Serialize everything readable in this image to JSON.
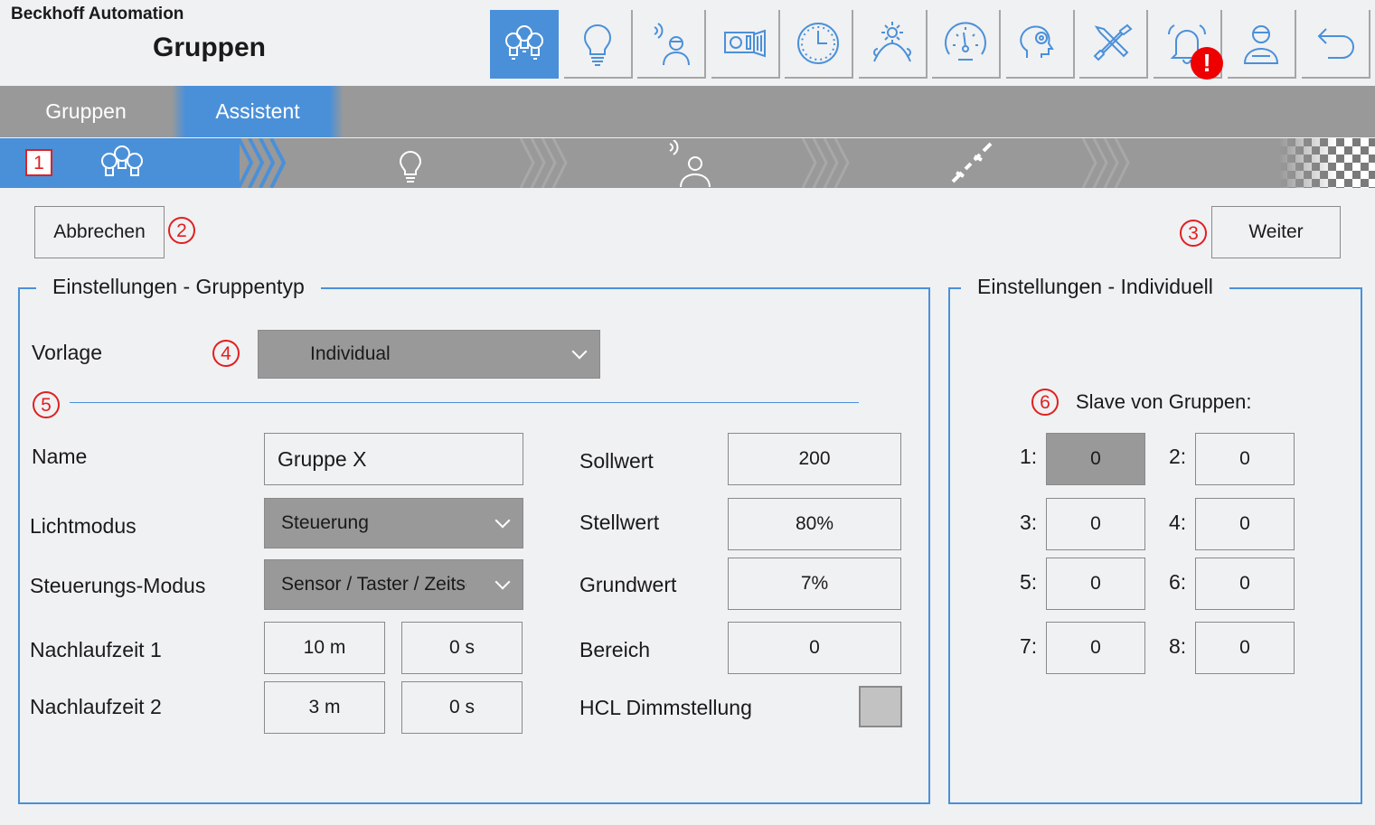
{
  "header": {
    "company": "Beckhoff Automation",
    "title": "Gruppen"
  },
  "toolbar": {
    "icons": [
      "groups-icon",
      "bulb-icon",
      "presence-sensor-icon",
      "projector-icon",
      "clock-icon",
      "daylight-icon",
      "speedometer-icon",
      "settings-head-icon",
      "tools-icon",
      "alarm-bell-icon",
      "user-icon",
      "back-icon"
    ],
    "alarm_badge": "!"
  },
  "tabs": [
    {
      "label": "Gruppen",
      "active": false
    },
    {
      "label": "Assistent",
      "active": true
    }
  ],
  "wizard": {
    "steps": [
      "groups-icon",
      "bulb-icon",
      "presence-sensor-icon",
      "link-broken-icon",
      "finish-flag-icon"
    ],
    "active_step": 0
  },
  "markers": {
    "m1": "1",
    "m2": "2",
    "m3": "3",
    "m4": "4",
    "m5": "5",
    "m6": "6"
  },
  "actions": {
    "cancel_label": "Abbrechen",
    "next_label": "Weiter"
  },
  "group_type": {
    "legend": "Einstellungen - Gruppentyp",
    "template_label": "Vorlage",
    "template_value": "Individual",
    "name_label": "Name",
    "name_value": "Gruppe X",
    "light_mode_label": "Lichtmodus",
    "light_mode_value": "Steuerung",
    "control_mode_label": "Steuerungs-Modus",
    "control_mode_value": "Sensor / Taster / Zeitschaltuhr",
    "run_on_1_label": "Nachlaufzeit 1",
    "run_on_1_min": "10 m",
    "run_on_1_sec": "0 s",
    "run_on_2_label": "Nachlaufzeit 2",
    "run_on_2_min": "3 m",
    "run_on_2_sec": "0 s",
    "setpoint_label": "Sollwert",
    "setpoint_value": "200",
    "output_label": "Stellwert",
    "output_value": "80%",
    "base_label": "Grundwert",
    "base_value": "7%",
    "area_label": "Bereich",
    "area_value": "0",
    "hcl_label": "HCL Dimmstellung",
    "hcl_checked": false
  },
  "individual": {
    "legend": "Einstellungen - Individuell",
    "slave_label": "Slave von Gruppen:",
    "slaves": [
      {
        "label": "1:",
        "value": "0"
      },
      {
        "label": "2:",
        "value": "0"
      },
      {
        "label": "3:",
        "value": "0"
      },
      {
        "label": "4:",
        "value": "0"
      },
      {
        "label": "5:",
        "value": "0"
      },
      {
        "label": "6:",
        "value": "0"
      },
      {
        "label": "7:",
        "value": "0"
      },
      {
        "label": "8:",
        "value": "0"
      }
    ]
  },
  "colors": {
    "accent": "#4a90d9",
    "bar": "#999999",
    "marker": "#e02020",
    "background": "#f0f1f3"
  }
}
